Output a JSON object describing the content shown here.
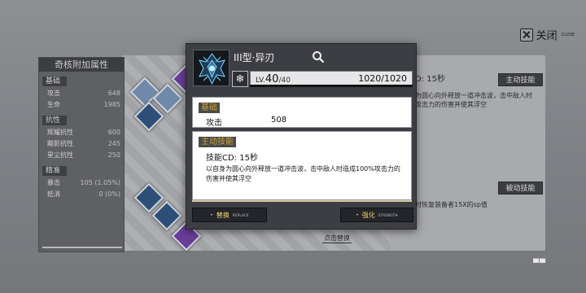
{
  "close": {
    "label": "关闭",
    "sub": "CLOSE"
  },
  "attributes": {
    "title": "奇核附加属性",
    "sections": [
      {
        "name": "基础",
        "rows": [
          {
            "label": "攻击",
            "value": "648"
          },
          {
            "label": "生命",
            "value": "1985"
          }
        ]
      },
      {
        "name": "抗性",
        "rows": [
          {
            "label": "辉耀抗性",
            "value": "600"
          },
          {
            "label": "黯影抗性",
            "value": "245"
          },
          {
            "label": "星尘抗性",
            "value": "250"
          }
        ]
      },
      {
        "name": "精准",
        "rows": [
          {
            "label": "暴击",
            "value": "105 (1.05%)"
          },
          {
            "label": "抵消",
            "value": "0 (0%)"
          }
        ]
      }
    ]
  },
  "background_right": {
    "active_tag": "主动技能",
    "cd_text": "D: 15秒",
    "desc_line1": "为圆心向外释放一道冲击波，击中敌人时",
    "desc_line2": "攻击力的伤害并使其浮空",
    "passive_tag": "被动技能",
    "passive_desc": "时恢复装备者15X的sp值"
  },
  "tap_hint": "点击替换",
  "bottom_marks": "▀▀",
  "modal": {
    "chip_name": "III型·异刃",
    "element_glyph": "❄",
    "level_prefix": "LV.",
    "level": "40",
    "level_max": "/40",
    "hp": "1020/1020",
    "level_progress": 1.0,
    "base_header": "基础",
    "base_stat_name": "攻击",
    "base_stat_value": "508",
    "skill_header": "主动技能",
    "skill_cd": "技能CD: 15秒",
    "skill_desc": "以自身为圆心向外释放一道冲击波，击中敌人时造成100%攻击力的伤害并使其浮空",
    "replace_label": "替换",
    "replace_sub": "REPLACE",
    "strength_label": "强化",
    "strength_sub": "STRENGTH"
  },
  "colors": {
    "accent_gold": "#f3d26f",
    "section_gold": "#cfa13b",
    "modal_bg": "#3d3e43"
  },
  "icons": [
    "close-icon",
    "search-icon",
    "snowflake-icon",
    "chip-avatar-icon"
  ]
}
